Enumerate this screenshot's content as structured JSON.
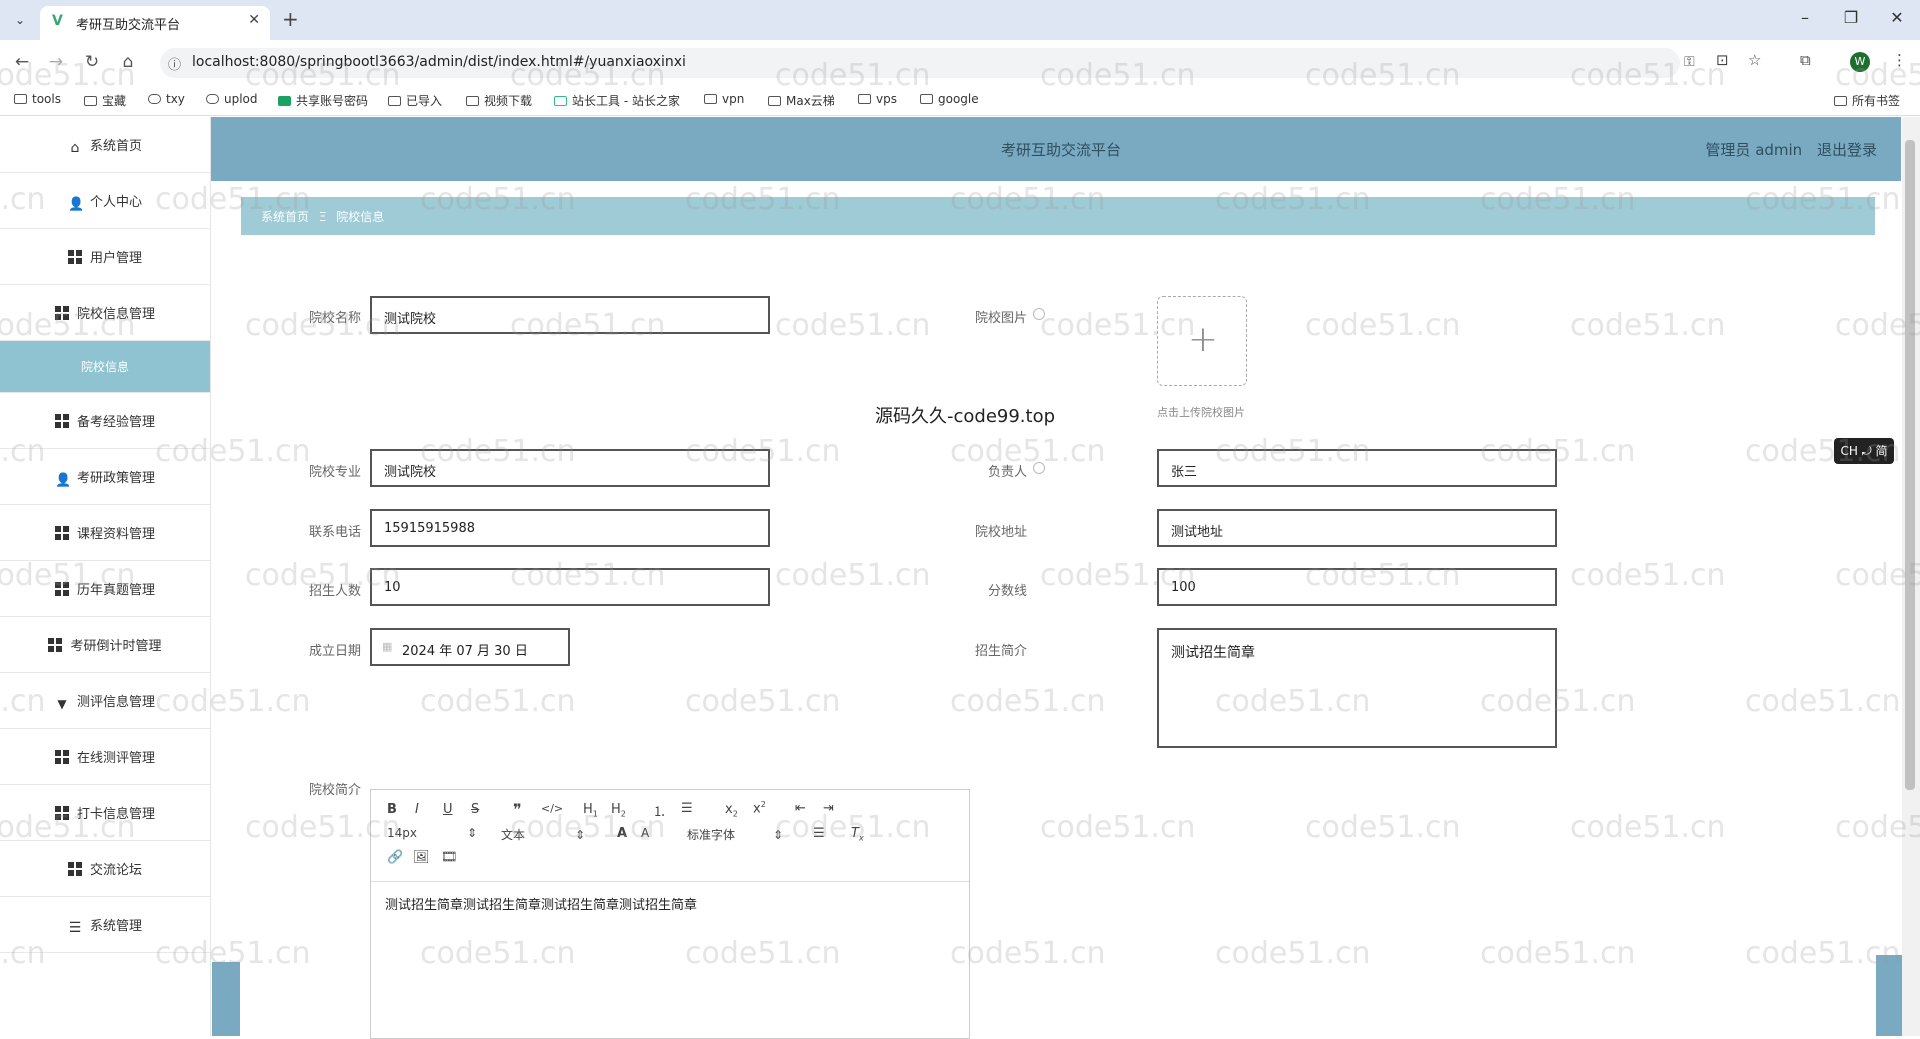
{
  "browser": {
    "tab_title": "考研互助交流平台",
    "url": "localhost:8080/springbootl3663/admin/dist/index.html#/yuanxiaoxinxi",
    "profile_initial": "W",
    "bookmarks": [
      "tools",
      "宝藏",
      "txy",
      "uplod",
      "共享账号密码",
      "已导入",
      "视频下载",
      "站长工具 - 站长之家",
      "vpn",
      "Max云梯",
      "vps",
      "google"
    ],
    "all_bookmarks": "所有书签"
  },
  "sidebar": {
    "items": [
      {
        "label": "系统首页",
        "icon": "home-icon"
      },
      {
        "label": "个人中心",
        "icon": "user-icon"
      },
      {
        "label": "用户管理",
        "icon": "grid-icon"
      },
      {
        "label": "院校信息管理",
        "icon": "grid-icon"
      },
      {
        "label": "院校信息",
        "icon": ""
      },
      {
        "label": "备考经验管理",
        "icon": "grid-icon"
      },
      {
        "label": "考研政策管理",
        "icon": "user-icon"
      },
      {
        "label": "课程资料管理",
        "icon": "grid-icon"
      },
      {
        "label": "历年真题管理",
        "icon": "grid-icon"
      },
      {
        "label": "考研倒计时管理",
        "icon": "grid-icon"
      },
      {
        "label": "测评信息管理",
        "icon": "funnel-icon"
      },
      {
        "label": "在线测评管理",
        "icon": "grid-icon"
      },
      {
        "label": "打卡信息管理",
        "icon": "grid-icon"
      },
      {
        "label": "交流论坛",
        "icon": "grid-icon"
      },
      {
        "label": "系统管理",
        "icon": "list-icon"
      }
    ]
  },
  "header": {
    "title": "考研互助交流平台",
    "user": "管理员 admin",
    "logout": "退出登录"
  },
  "breadcrumb": {
    "home": "系统首页",
    "separator": "Ξ",
    "current": "院校信息"
  },
  "form": {
    "school_name_label": "院校名称",
    "school_name": "测试院校",
    "school_image_label": "院校图片",
    "upload_hint": "点击上传院校图片",
    "major_label": "院校专业",
    "major": "测试院校",
    "principal_label": "负责人",
    "principal": "张三",
    "phone_label": "联系电话",
    "phone": "15915915988",
    "address_label": "院校地址",
    "address": "测试地址",
    "enroll_label": "招生人数",
    "enroll": "10",
    "score_label": "分数线",
    "score": "100",
    "date_label": "成立日期",
    "date": "2024 年 07 月 30 日",
    "brochure_label": "招生简介",
    "brochure": "测试招生简章",
    "intro_label": "院校简介",
    "intro_content": "测试招生简章测试招生简章测试招生简章测试招生简章"
  },
  "editor": {
    "font_size": "14px",
    "text_type": "文本",
    "font_family": "标准字体"
  },
  "overlay": {
    "site_mark": "源码久久-code99.top",
    "ime": "CH ⤾ 简",
    "watermark": "code51.cn"
  }
}
